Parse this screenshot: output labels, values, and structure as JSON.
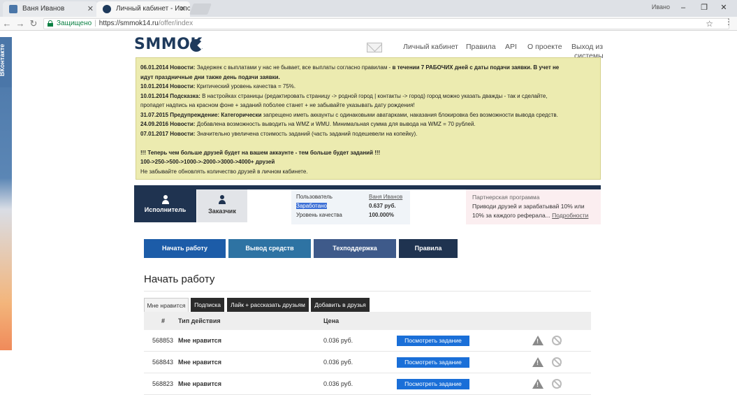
{
  "browser": {
    "tabs": [
      {
        "title": "Ваня Иванов"
      },
      {
        "title": "Личный кабинет - Испо"
      }
    ],
    "user": "Ивано",
    "address": {
      "secure_label": "Защищено",
      "url_host": "https://smmok14.ru",
      "url_path": "/offer/index"
    }
  },
  "vk_widget": {
    "label": "ВКонтакте"
  },
  "site": {
    "logo": "SMMOK",
    "nav": [
      "Личный кабинет",
      "Правила",
      "API",
      "О проекте"
    ],
    "logout_line1": "Выход из",
    "logout_line2": "системы"
  },
  "notice": {
    "l1_date": "06.01.2014 Новости:",
    "l1_text": " Задержек с выплатами у нас не бывает, все выплаты согласно правилам - ",
    "l1_bold": "в течении 7 РАБОЧИХ дней с даты подачи заявки. В учет не",
    "l1b_bold": "идут праздничные дни также день подачи заявки.",
    "l2_date": "10.01.2014 Новости:",
    "l2_text": " Критический уровень качества = 75%.",
    "l3_date": "10.01.2014 Подсказка:",
    "l3_text": " В настройках страницы (редактировать страницу -> родной город | контакты -> город) город можно указать дважды - так и сделайте,",
    "l3b_text": "пропадет надпись на красном фоне + заданий поболее станет + не забывайте указывать дату рождения!",
    "l4_date": "31.07.2015 Предупреждение:",
    "l4_bold": " Категорически",
    "l4_text": " запрещено иметь аккаунты с одинаковыми аватарками, наказания блокировка без возможности вывода средств.",
    "l5_date": "24.09.2016 Новости:",
    "l5_text": " Добавлена возможность выводить на WMZ и WMU. Минимальная сумма для вывода на WMZ = 70 рублей.",
    "l6_date": "07.01.2017 Новости:",
    "l6_text": " Значительно увеличена стоимость заданий (часть заданий подешевели на копейку).",
    "l7_bold": "!!! Теперь чем больше друзей будет на вашем аккаунте - тем больше будет заданий !!!",
    "l8_bold": "100->250->500->1000->-2000->3000->4000+ друзей",
    "l9_text": "Не забывайте обновлять количество друзей в личном кабинете."
  },
  "roles": {
    "executor": "Исполнитель",
    "customer": "Заказчик"
  },
  "stats": {
    "user_label": "Пользователь",
    "user_value": "Ваня Иванов",
    "earned_label": "Заработано",
    "earned_value": "0.637 руб.",
    "quality_label": "Уровень качества",
    "quality_value": "100.000%"
  },
  "partner": {
    "title": "Партнерская программа",
    "line1": "Приводи друзей и зарабатывай 10% или",
    "line2": "10% за каждого реферала...",
    "link": "Подробности"
  },
  "actions": [
    "Начать работу",
    "Вывод средств",
    "Техподдержка",
    "Правила"
  ],
  "section_title": "Начать работу",
  "task_tabs": [
    "Мне нравится",
    "Подписка",
    "Лайк + рассказать друзьям",
    "Добавить в друзья"
  ],
  "table": {
    "headers": [
      "#",
      "Тип действия",
      "Цена"
    ],
    "view_label": "Посмотреть задание",
    "rows": [
      {
        "id": "568853",
        "type": "Мне нравится",
        "price": "0.036 руб."
      },
      {
        "id": "568843",
        "type": "Мне нравится",
        "price": "0.036 руб."
      },
      {
        "id": "568823",
        "type": "Мне нравится",
        "price": "0.036 руб."
      }
    ]
  }
}
